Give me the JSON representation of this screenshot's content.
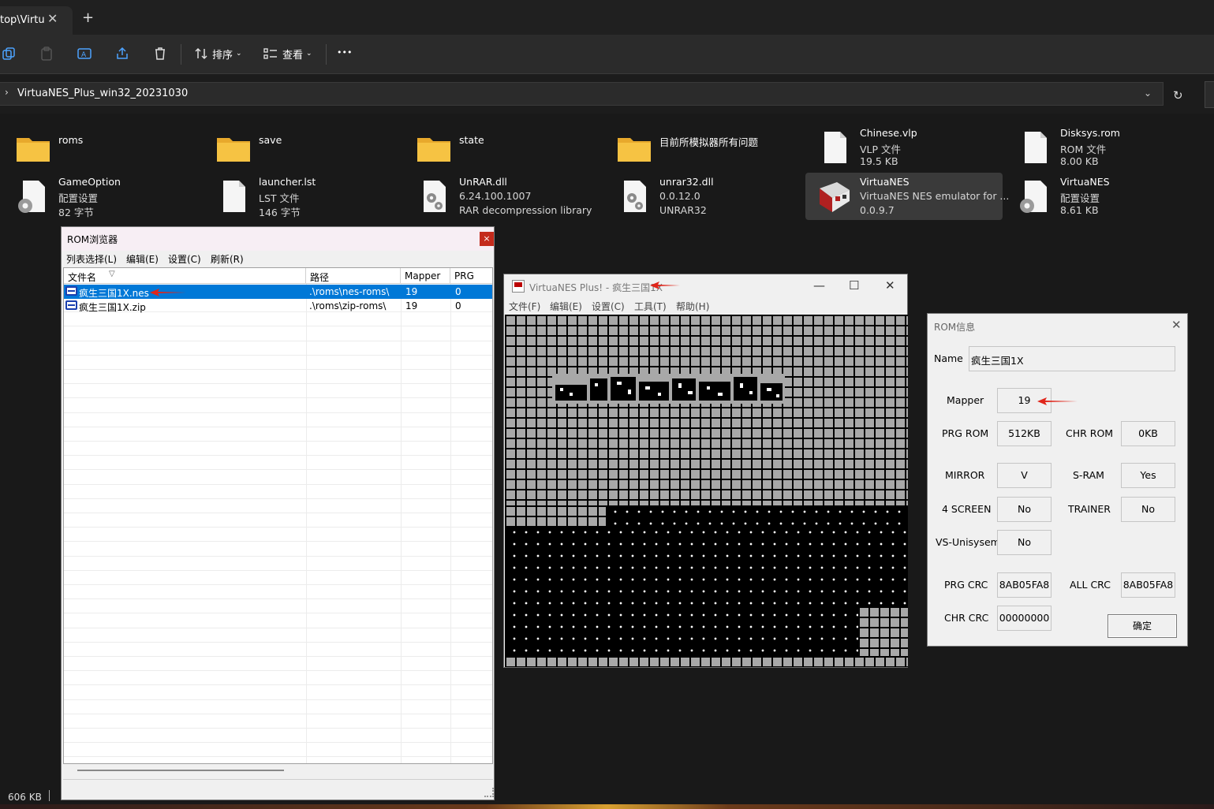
{
  "explorer": {
    "tab_title": "top\\Virtu",
    "toolbar": {
      "sort_label": "排序",
      "view_label": "查看",
      "more_label": "•••"
    },
    "address": "VirtuaNES_Plus_win32_20231030",
    "files": [
      {
        "name": "roms",
        "kind": "folder"
      },
      {
        "name": "save",
        "kind": "folder"
      },
      {
        "name": "state",
        "kind": "folder"
      },
      {
        "name": "目前所模拟器所有问题",
        "kind": "folder"
      },
      {
        "name": "Chinese.vlp",
        "type": "VLP 文件",
        "size": "19.5 KB",
        "kind": "file"
      },
      {
        "name": "Disksys.rom",
        "type": "ROM 文件",
        "size": "8.00 KB",
        "kind": "file"
      },
      {
        "name": "GameOption",
        "type": "配置设置",
        "size": "82 字节",
        "kind": "config"
      },
      {
        "name": "launcher.lst",
        "type": "LST 文件",
        "size": "146 字节",
        "kind": "file"
      },
      {
        "name": "UnRAR.dll",
        "type": "6.24.100.1007",
        "size": "RAR decompression library",
        "kind": "dll"
      },
      {
        "name": "unrar32.dll",
        "type": "0.0.12.0",
        "size": "UNRAR32",
        "kind": "dll"
      },
      {
        "name": "VirtuaNES",
        "type": "VirtuaNES NES emulator for ...",
        "size": "0.0.9.7",
        "kind": "exe"
      },
      {
        "name": "VirtuaNES",
        "type": "配置设置",
        "size": "8.61 KB",
        "kind": "config"
      }
    ],
    "status_size": "606 KB"
  },
  "rom_browser": {
    "title": "ROM浏览器",
    "close": "×",
    "menu": [
      "列表选择(L)",
      "编辑(E)",
      "设置(C)",
      "刷新(R)"
    ],
    "columns": [
      "文件名",
      "路径",
      "Mapper",
      "PRG"
    ],
    "sort_glyph": "▽",
    "rows": [
      {
        "file": "疯生三国1X.nes",
        "path": ".\\roms\\nes-roms\\",
        "mapper": "19",
        "prg": "0",
        "selected": true
      },
      {
        "file": "疯生三国1X.zip",
        "path": ".\\roms\\zip-roms\\",
        "mapper": "19",
        "prg": "0",
        "selected": false
      }
    ]
  },
  "nes_window": {
    "title": "VirtuaNES Plus! - 疯生三国1X",
    "minimize": "—",
    "maximize": "☐",
    "close": "✕",
    "menu": [
      "文件(F)",
      "编辑(E)",
      "设置(C)",
      "工具(T)",
      "帮助(H)"
    ]
  },
  "rom_info": {
    "title": "ROM信息",
    "close": "✕",
    "name_label": "Name",
    "name_value": "疯生三国1X",
    "fields": {
      "mapper": {
        "label": "Mapper",
        "value": "19"
      },
      "prg_rom": {
        "label": "PRG ROM",
        "value": "512KB"
      },
      "chr_rom": {
        "label": "CHR ROM",
        "value": "0KB"
      },
      "mirror": {
        "label": "MIRROR",
        "value": "V"
      },
      "sram": {
        "label": "S-RAM",
        "value": "Yes"
      },
      "four_screen": {
        "label": "4 SCREEN",
        "value": "No"
      },
      "trainer": {
        "label": "TRAINER",
        "value": "No"
      },
      "vs_unisystem": {
        "label": "VS-Unisysem",
        "value": "No"
      },
      "prg_crc": {
        "label": "PRG CRC",
        "value": "8AB05FA8"
      },
      "all_crc": {
        "label": "ALL CRC",
        "value": "8AB05FA8"
      },
      "chr_crc": {
        "label": "CHR CRC",
        "value": "00000000"
      }
    },
    "ok_label": "确定"
  },
  "colors": {
    "explorer_bg": "#191919",
    "selection_blue": "#0078d7",
    "folder_yellow": "#f6c343",
    "annotation_red": "#e0261b"
  }
}
